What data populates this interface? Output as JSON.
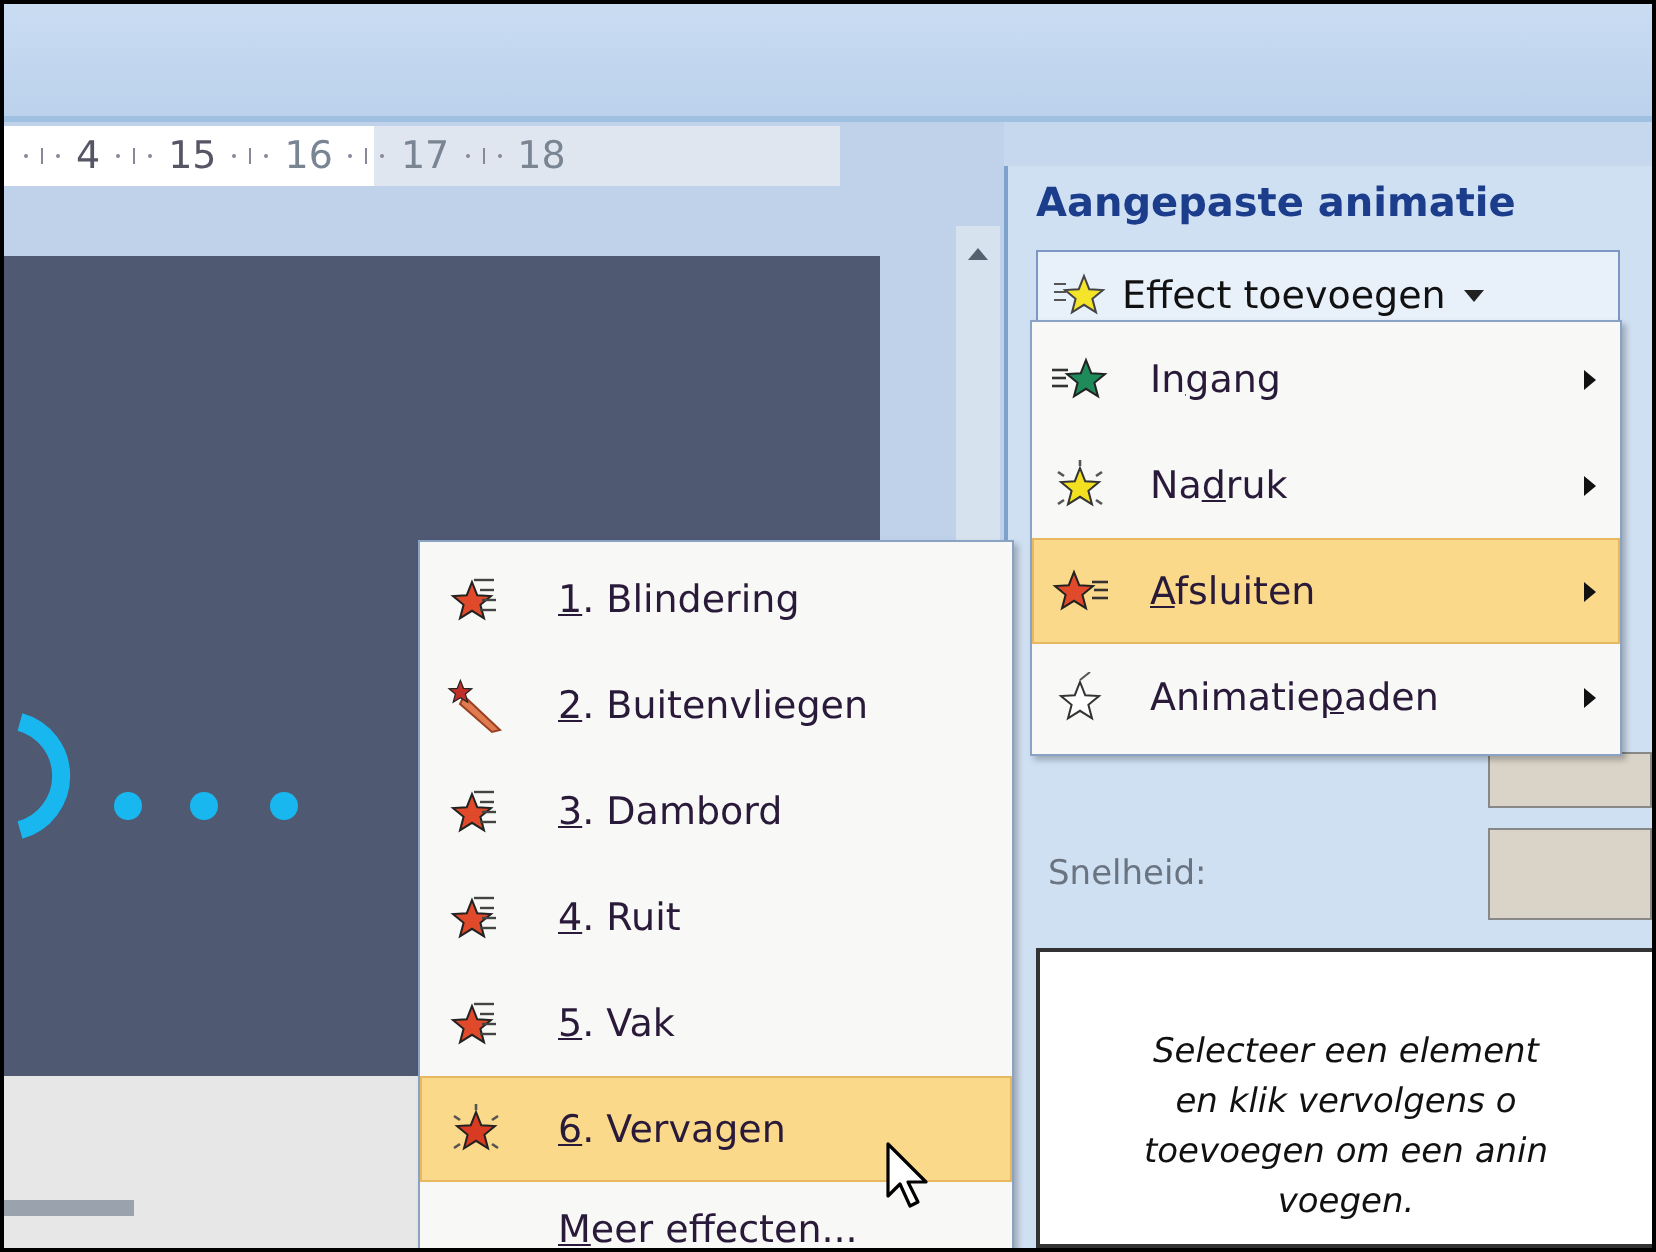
{
  "ruler": {
    "labels": [
      "4",
      "15",
      "16",
      "17",
      "18"
    ]
  },
  "task_pane": {
    "title": "Aangepaste animatie",
    "add_effect_button": "Effect toevoegen",
    "speed_label": "Snelheid:",
    "hint": "Selecteer een element\nen klik vervolgens o\ntoevoegen om een anin\nvoegen."
  },
  "effect_menu": [
    {
      "kind": "entrance",
      "before": "In",
      "key": "g",
      "after": "ang",
      "selected": false
    },
    {
      "kind": "emphasis",
      "before": "Na",
      "key": "d",
      "after": "ruk",
      "selected": false
    },
    {
      "kind": "exit",
      "key": "A",
      "after": "fsluiten",
      "selected": true
    },
    {
      "kind": "path",
      "before": "Animatie",
      "key": "p",
      "after": "aden",
      "selected": false
    }
  ],
  "exit_submenu": {
    "items": [
      {
        "kind": "lines",
        "key": "1",
        "after": ". Blindering",
        "selected": false
      },
      {
        "kind": "fly",
        "key": "2",
        "after": ". Buitenvliegen",
        "selected": false
      },
      {
        "kind": "lines",
        "key": "3",
        "after": ". Dambord",
        "selected": false
      },
      {
        "kind": "lines",
        "key": "4",
        "after": ". Ruit",
        "selected": false
      },
      {
        "kind": "lines",
        "key": "5",
        "after": ". Vak",
        "selected": false
      },
      {
        "kind": "burst",
        "key": "6",
        "after": ". Vervagen",
        "selected": true
      }
    ],
    "more": {
      "key": "M",
      "after": "eer effecten..."
    }
  }
}
